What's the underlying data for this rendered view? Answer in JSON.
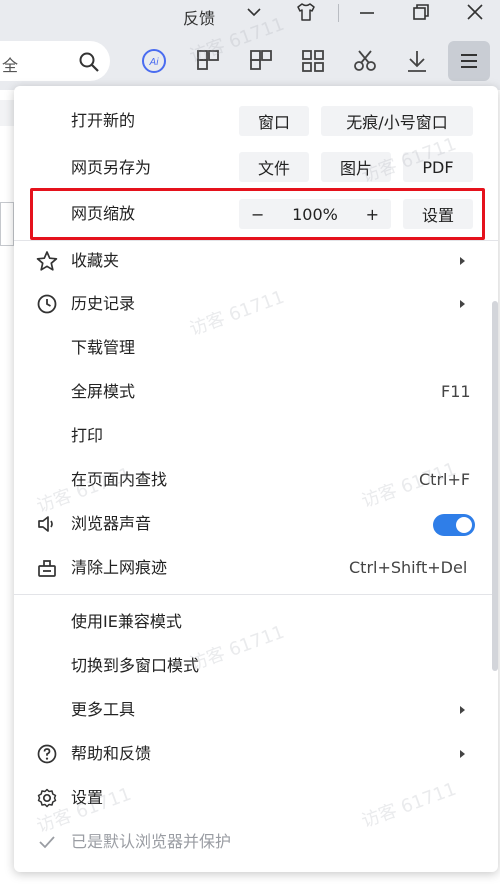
{
  "titlebar": {
    "feedback_label": "反馈"
  },
  "toolbar": {
    "address_text": "全",
    "ai_label": "Ai"
  },
  "menu": {
    "new_row": {
      "label": "打开新的",
      "btn_window": "窗口",
      "btn_incognito": "无痕/小号窗口"
    },
    "saveas_row": {
      "label": "网页另存为",
      "btn_file": "文件",
      "btn_image": "图片",
      "btn_pdf": "PDF"
    },
    "zoom_row": {
      "label": "网页缩放",
      "minus": "−",
      "value": "100%",
      "plus": "+",
      "settings": "设置"
    },
    "items": {
      "favorites": "收藏夹",
      "history": "历史记录",
      "downloads": "下载管理",
      "fullscreen": "全屏模式",
      "fullscreen_shortcut": "F11",
      "print": "打印",
      "find": "在页面内查找",
      "find_shortcut": "Ctrl+F",
      "sound": "浏览器声音",
      "sound_enabled": true,
      "clear": "清除上网痕迹",
      "clear_shortcut": "Ctrl+Shift+Del",
      "ie_mode": "使用IE兼容模式",
      "multi_window": "切换到多窗口模式",
      "more_tools": "更多工具",
      "help": "帮助和反馈",
      "settings": "设置",
      "default_browser": "已是默认浏览器并保护"
    },
    "watermark": "访客 61711"
  },
  "colors": {
    "accent": "#2f7ee8",
    "highlight": "#e5121c"
  }
}
